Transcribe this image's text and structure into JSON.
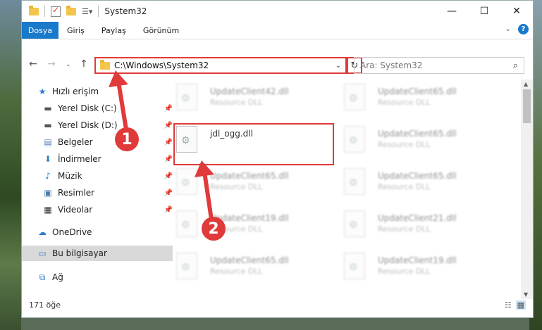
{
  "window": {
    "title": "System32"
  },
  "ribbon": {
    "tabs": [
      "Dosya",
      "Giriş",
      "Paylaş",
      "Görünüm"
    ]
  },
  "address": {
    "path": "C:\\Windows\\System32",
    "search_placeholder": "Ara: System32"
  },
  "sidebar": {
    "items": [
      {
        "label": "Hızlı erişim",
        "icon": "star-icon",
        "pinned": false
      },
      {
        "label": "Yerel Disk (C:)",
        "icon": "drive-icon",
        "pinned": true
      },
      {
        "label": "Yerel Disk (D:)",
        "icon": "drive-icon",
        "pinned": true
      },
      {
        "label": "Belgeler",
        "icon": "documents-icon",
        "pinned": true
      },
      {
        "label": "İndirmeler",
        "icon": "download-icon",
        "pinned": true
      },
      {
        "label": "Müzik",
        "icon": "music-icon",
        "pinned": true
      },
      {
        "label": "Resimler",
        "icon": "pictures-icon",
        "pinned": true
      },
      {
        "label": "Videolar",
        "icon": "videos-icon",
        "pinned": true
      },
      {
        "label": "OneDrive",
        "icon": "cloud-icon",
        "pinned": false
      },
      {
        "label": "Bu bilgisayar",
        "icon": "computer-icon",
        "pinned": false,
        "selected": true
      },
      {
        "label": "Ağ",
        "icon": "network-icon",
        "pinned": false
      }
    ]
  },
  "files": [
    {
      "name": "UpdateClient42.dll",
      "type": "Resource DLL"
    },
    {
      "name": "UpdateClient65.dll",
      "type": "Resource DLL"
    },
    {
      "name": "jdl_ogg.dll",
      "type": ""
    },
    {
      "name": "UpdateClient65.dll",
      "type": "Resource DLL"
    },
    {
      "name": "UpdateClient65.dll",
      "type": "Resource DLL"
    },
    {
      "name": "UpdateClient65.dll",
      "type": "Resource DLL"
    },
    {
      "name": "UpdateClient19.dll",
      "type": "Resource DLL"
    },
    {
      "name": "UpdateClient21.dll",
      "type": "Resource DLL"
    },
    {
      "name": "UpdateClient65.dll",
      "type": "Resource DLL"
    },
    {
      "name": "UpdateClient19.dll",
      "type": "Resource DLL"
    }
  ],
  "status": {
    "item_count": "171 öğe"
  },
  "annotations": {
    "step1": "1",
    "step2": "2",
    "color": "#e03a3a"
  }
}
